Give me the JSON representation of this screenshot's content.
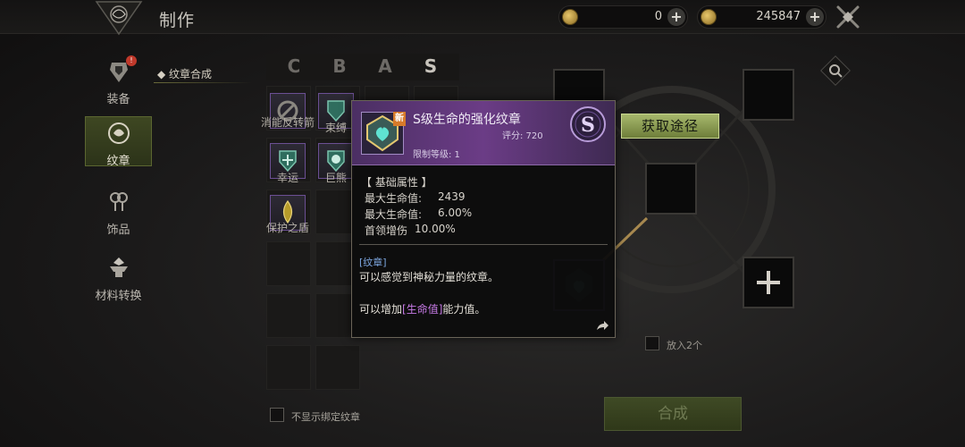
{
  "header": {
    "title": "制作",
    "currency1": {
      "value": "0",
      "icon": "coin-icon"
    },
    "currency2": {
      "value": "245847",
      "icon": "gold-icon"
    }
  },
  "sidebar": {
    "items": [
      {
        "label": "装备",
        "icon": "armor-icon",
        "badge": "!"
      },
      {
        "label": "纹章",
        "icon": "emblem-icon",
        "active": true
      },
      {
        "label": "饰品",
        "icon": "accessory-icon"
      },
      {
        "label": "材料转换",
        "icon": "anvil-icon"
      }
    ]
  },
  "subtab": {
    "label": "纹章合成"
  },
  "grades": [
    "C",
    "B",
    "A",
    "S"
  ],
  "grid_items": [
    {
      "label": "消能反转箭",
      "icon": "ban-icon"
    },
    {
      "label": "束缚",
      "icon": "shield-icon"
    },
    {
      "label": "幸运",
      "icon": "shield-plus-icon"
    },
    {
      "label": "巨熊",
      "icon": "bear-shield-icon"
    },
    {
      "label": "保护之盾",
      "icon": "drop-shield-icon"
    }
  ],
  "hide_bound": {
    "label": "不显示绑定纹章"
  },
  "craft": {
    "put2_label": "放入2个",
    "combine_label": "合成",
    "get_source_label": "获取途径"
  },
  "tooltip": {
    "new_tag": "新",
    "name": "S级生命的强化纹章",
    "score": "评分: 720",
    "level_req": "限制等级: 1",
    "grade": "S",
    "section_title": "【 基础属性 】",
    "attrs": [
      {
        "name": "最大生命值:",
        "value": "2439"
      },
      {
        "name": "最大生命值:",
        "value": "6.00%"
      },
      {
        "name": "首领增伤",
        "value": "10.00%"
      }
    ],
    "category": "[纹章]",
    "desc1": "可以感觉到神秘力量的纹章。",
    "desc2_pre": "可以增加",
    "desc2_hl": "[生命值]",
    "desc2_post": "能力值。"
  },
  "colors": {
    "accent_green": "#a7b86c",
    "tooltip_purple": "#6b3c86",
    "hp_highlight": "#c77ae6",
    "category_blue": "#7da6e0"
  }
}
